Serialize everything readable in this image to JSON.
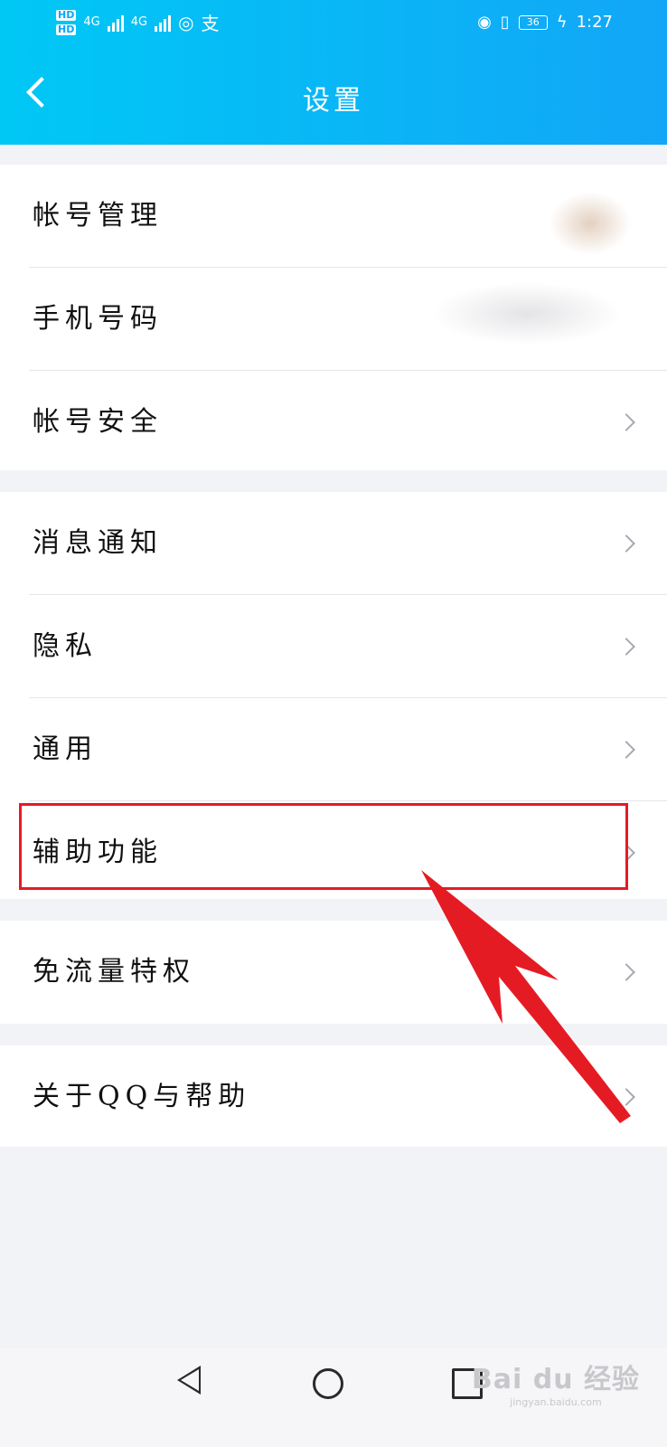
{
  "status_bar": {
    "network_left": [
      "HD",
      "HD"
    ],
    "net1": "4G",
    "net2": "4G",
    "extra": "支",
    "battery": "36",
    "time": "1:27"
  },
  "header": {
    "title": "设置"
  },
  "groups": [
    [
      {
        "label": "帐号管理",
        "chevron": false
      },
      {
        "label": "手机号码",
        "chevron": false
      },
      {
        "label": "帐号安全",
        "chevron": true
      }
    ],
    [
      {
        "label": "消息通知",
        "chevron": true
      },
      {
        "label": "隐私",
        "chevron": true
      },
      {
        "label": "通用",
        "chevron": true
      },
      {
        "label": "辅助功能",
        "chevron": true
      }
    ],
    [
      {
        "label": "免流量特权",
        "chevron": true
      }
    ],
    [
      {
        "label": "关于QQ与帮助",
        "chevron": true
      }
    ]
  ],
  "annotation": {
    "highlighted_item": "辅助功能",
    "color": "#e51b24"
  },
  "watermark": {
    "brand": "Bai du 经验",
    "url": "jingyan.baidu.com"
  },
  "colors": {
    "header_start": "#00c8f5",
    "header_end": "#12a6f7",
    "background": "#f2f3f7"
  }
}
